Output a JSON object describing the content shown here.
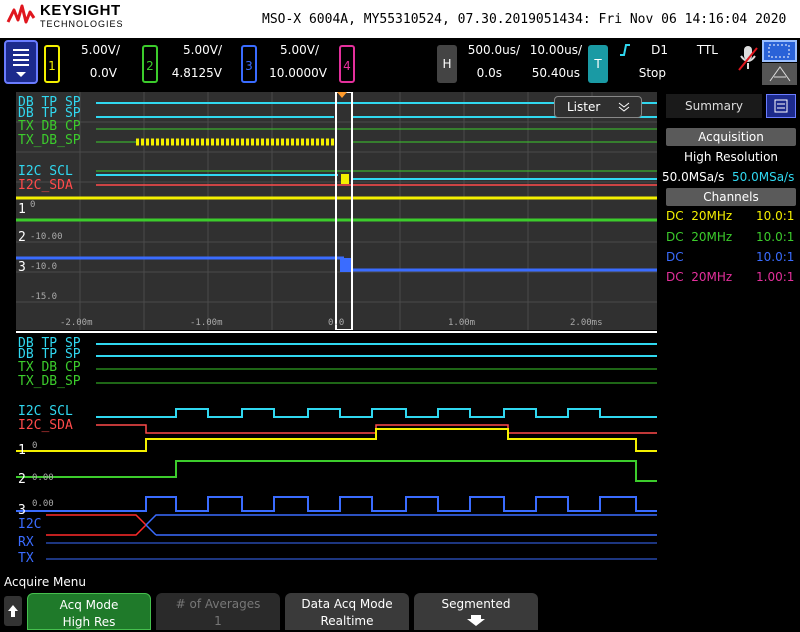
{
  "header": {
    "brand": "KEYSIGHT",
    "brand_sub": "TECHNOLOGIES",
    "model_line": "MSO-X 6004A, MY55310524, 07.30.2019051434: Fri Nov 06 14:16:04 2020"
  },
  "channels": [
    {
      "num": "1",
      "scale": "5.00V/",
      "offset": "0.0V",
      "color": "#f4f000"
    },
    {
      "num": "2",
      "scale": "5.00V/",
      "offset": "4.8125V",
      "color": "#3ccc2c"
    },
    {
      "num": "3",
      "scale": "5.00V/",
      "offset": "10.0000V",
      "color": "#3a6cff"
    },
    {
      "num": "4",
      "color": "#e4309c"
    }
  ],
  "horizontal": {
    "key": "H",
    "scale": "500.0us/",
    "delay": "0.0s",
    "sample": "10.00us/",
    "time": "50.40us"
  },
  "trigger": {
    "key": "T",
    "source": "D1",
    "mode": "Stop",
    "level": "TTL",
    "edge_icon": "rising-edge-icon"
  },
  "upper": {
    "digital_labels": [
      {
        "d": "D",
        "sub": "0",
        "text": "DB TP SP"
      },
      {
        "d": "D",
        "sub": "1",
        "text": "DB TP SP"
      },
      {
        "d": "D",
        "sub": "4",
        "text": "TX DB CP"
      },
      {
        "d": "D",
        "sub": "5",
        "text": "TX_DB_SP"
      }
    ],
    "i2c_labels": [
      {
        "d": "D",
        "sub": "2",
        "text": "I2C SCL"
      },
      {
        "d": "D",
        "sub": "3",
        "text": "I2C_SDA"
      }
    ],
    "analog_labels": [
      "1",
      "2",
      "3"
    ],
    "y_ticks": [
      "0",
      "-10.00",
      "-10.0",
      "-15.0"
    ],
    "x_ticks": [
      "-2.00m",
      "-1.00m",
      "0.0",
      "1.00m",
      "2.00ms"
    ],
    "lister_label": "Lister"
  },
  "lower": {
    "digital_labels": [
      {
        "d": "D",
        "sub": "0",
        "text": "DB TP SP"
      },
      {
        "d": "D",
        "sub": "1",
        "text": "DB TP SP"
      },
      {
        "d": "D",
        "sub": "4",
        "text": "TX DB CP"
      },
      {
        "d": "D",
        "sub": "5",
        "text": "TX_DB_SP"
      }
    ],
    "i2c_labels": [
      {
        "d": "D",
        "sub": "2",
        "text": "I2C SCL"
      },
      {
        "d": "D",
        "sub": "3",
        "text": "I2C_SDA"
      }
    ],
    "analog_labels": [
      "1",
      "2",
      "3"
    ],
    "y_ticks": [
      "0",
      "0.00",
      "0.00"
    ],
    "serial_labels": [
      {
        "s": "S",
        "sub": "1",
        "text": "I2C"
      },
      {
        "s": "S",
        "sub": "2",
        "text": "RX"
      },
      {
        "s": "",
        "sub": "",
        "text": "TX"
      }
    ]
  },
  "panel": {
    "tab_label": "Summary",
    "acq_title": "Acquisition",
    "acq_mode": "High Resolution",
    "rate1": "50.0MSa/s",
    "rate2": "50.0MSa/s",
    "channels_title": "Channels",
    "rows": [
      {
        "coupling": "DC",
        "bw": "20MHz",
        "probe": "10.0:1",
        "color": "#f4f000"
      },
      {
        "coupling": "DC",
        "bw": "20MHz",
        "probe": "10.0:1",
        "color": "#3ccc2c"
      },
      {
        "coupling": "DC",
        "bw": "",
        "probe": "10.0:1",
        "color": "#3a6cff"
      },
      {
        "coupling": "DC",
        "bw": "20MHz",
        "probe": "1.00:1",
        "color": "#e4309c"
      }
    ]
  },
  "softkeys": {
    "menu_title": "Acquire Menu",
    "acq_mode_label": "Acq Mode",
    "acq_mode_value": "High Res",
    "averages_label": "# of Averages",
    "averages_value": "1",
    "data_acq_label": "Data Acq Mode",
    "data_acq_value": "Realtime",
    "segmented_label": "Segmented"
  },
  "colors": {
    "yellow": "#f4f000",
    "green": "#3ccc2c",
    "blue": "#3a6cff",
    "cyan": "#30d8f0",
    "red": "#ff4a4a",
    "orange": "#ff9a2a"
  }
}
